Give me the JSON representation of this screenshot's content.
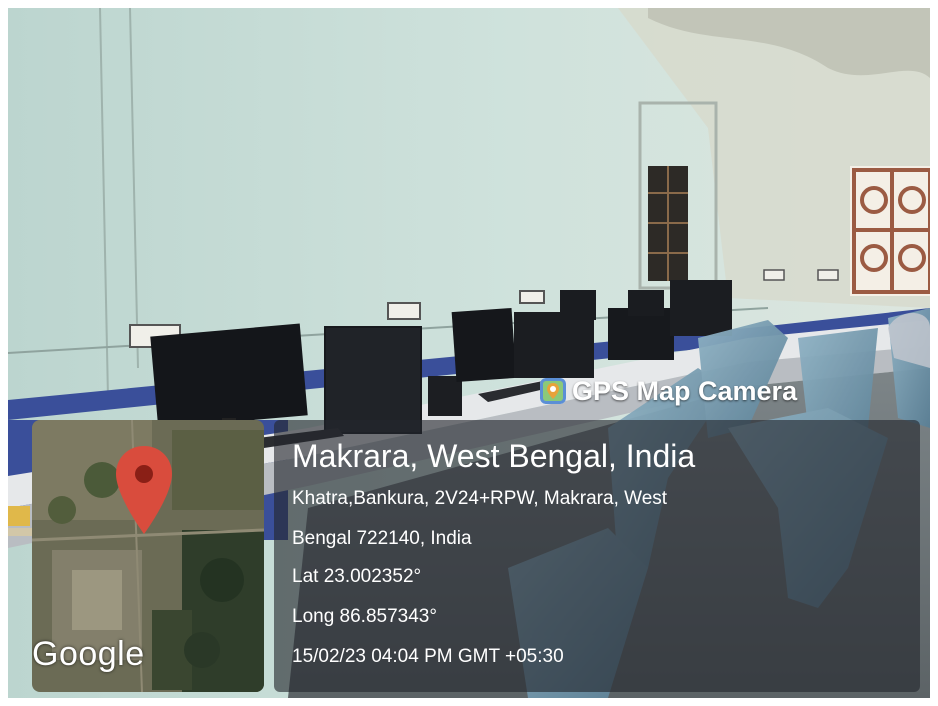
{
  "app": {
    "badge_label": "GPS Map Camera",
    "icon": "gps-map-camera-icon"
  },
  "location": {
    "title": "Makrara, West Bengal, India",
    "address_line_1": "Khatra,Bankura, 2V24+RPW, Makrara, West",
    "address_line_2": "Bengal 722140, India",
    "lat": "Lat 23.002352°",
    "long": "Long 86.857343°",
    "timestamp": "15/02/23 04:04 PM GMT +05:30"
  },
  "map": {
    "provider_label": "Google",
    "marker_icon": "map-pin-icon",
    "marker_color": "#d94c3d"
  },
  "colors": {
    "wall": "#cfe1da",
    "panel_bg": "#23262d",
    "accent_blue": "#3a4f9a"
  }
}
